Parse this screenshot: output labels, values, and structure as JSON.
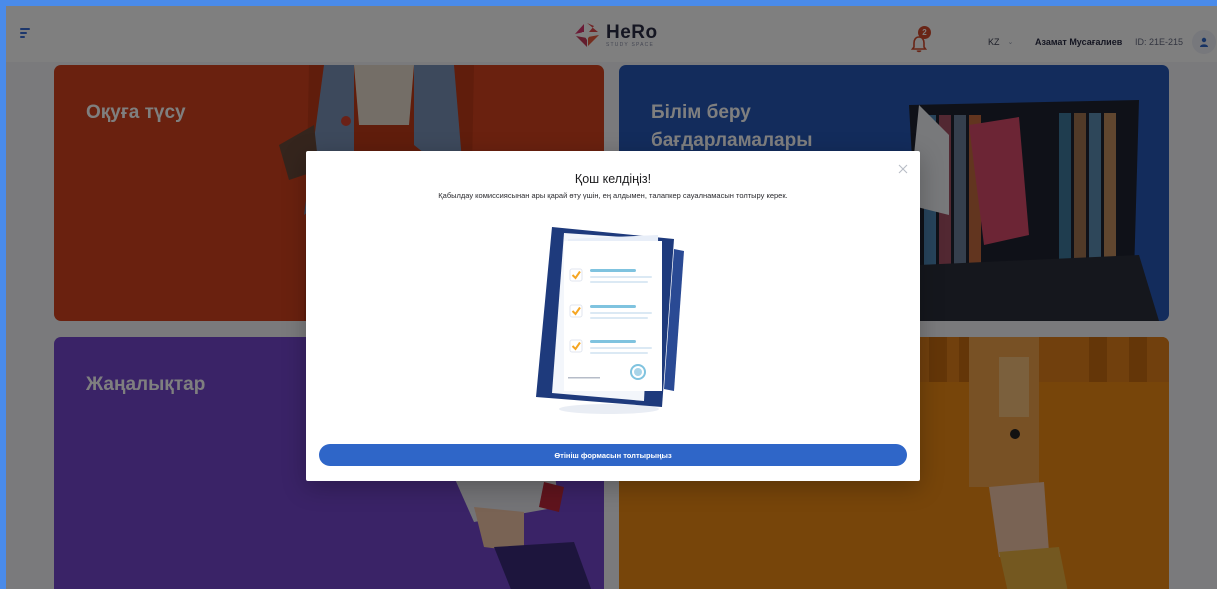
{
  "header": {
    "logo_name": "HeRo",
    "logo_sub": "STUDY SPACE",
    "notification_count": "2",
    "language": "KZ",
    "user_name": "Азамат Мусағалиев",
    "user_id": "ID: 21E-215"
  },
  "tiles": [
    {
      "title": "Оқуға түсу",
      "color": "#d4431e"
    },
    {
      "title": "Білім беру бағдарламалары",
      "color": "#2658b9"
    },
    {
      "title": "Жаңалықтар",
      "color": "#7446cf"
    },
    {
      "title": "",
      "color": "#ef8a14"
    }
  ],
  "modal": {
    "title": "Қош келдіңіз!",
    "text": "Қабылдау комиссиясынан ары қарай өту үшін, ең алдымен, талапкер сауалнамасын толтыру керек.",
    "button_label": "Өтініш формасын толтырыңыз"
  },
  "colors": {
    "accent": "#2f66c8",
    "frame": "#4a8bea",
    "badge": "#d34a2c"
  }
}
